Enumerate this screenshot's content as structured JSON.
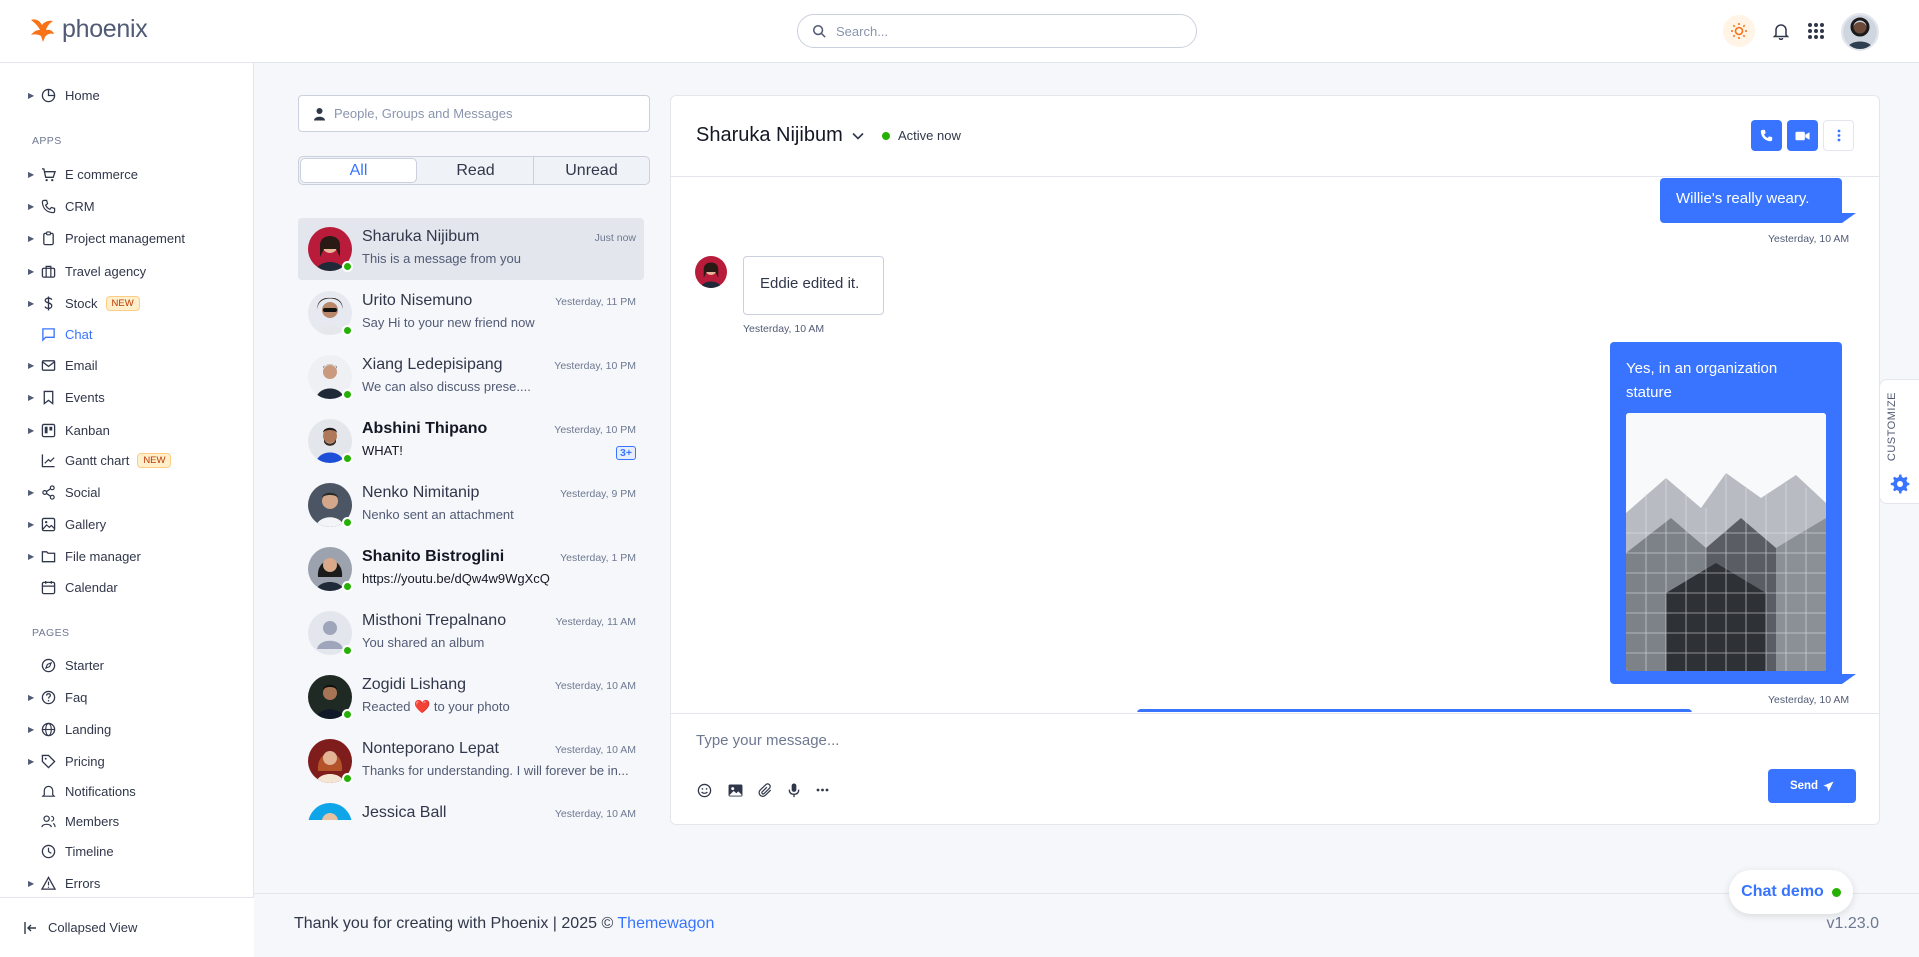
{
  "brand": {
    "name": "phoenix"
  },
  "topbar": {
    "search_placeholder": "Search..."
  },
  "sidebar": {
    "home": "Home",
    "apps_heading": "APPS",
    "apps": [
      {
        "label": "E commerce",
        "icon": "cart-icon"
      },
      {
        "label": "CRM",
        "icon": "phone-icon"
      },
      {
        "label": "Project management",
        "icon": "clipboard-icon"
      },
      {
        "label": "Travel agency",
        "icon": "briefcase-icon"
      },
      {
        "label": "Stock",
        "icon": "dollar-icon",
        "badge": "NEW"
      },
      {
        "label": "Chat",
        "icon": "message-square-icon",
        "active": true
      },
      {
        "label": "Email",
        "icon": "mail-icon"
      },
      {
        "label": "Events",
        "icon": "bookmark-icon"
      },
      {
        "label": "Kanban",
        "icon": "trello-icon"
      },
      {
        "label": "Gantt chart",
        "icon": "bar-chart-icon",
        "badge": "NEW"
      },
      {
        "label": "Social",
        "icon": "share-icon"
      },
      {
        "label": "Gallery",
        "icon": "image-icon"
      },
      {
        "label": "File manager",
        "icon": "folder-icon"
      },
      {
        "label": "Calendar",
        "icon": "calendar-icon"
      }
    ],
    "pages_heading": "PAGES",
    "pages": [
      {
        "label": "Starter",
        "icon": "compass-icon"
      },
      {
        "label": "Faq",
        "icon": "help-circle-icon"
      },
      {
        "label": "Landing",
        "icon": "globe-icon"
      },
      {
        "label": "Pricing",
        "icon": "tag-icon"
      },
      {
        "label": "Notifications",
        "icon": "bell-icon"
      },
      {
        "label": "Members",
        "icon": "users-icon"
      },
      {
        "label": "Timeline",
        "icon": "clock-icon"
      },
      {
        "label": "Errors",
        "icon": "alert-triangle-icon"
      }
    ],
    "collapse_label": "Collapsed View"
  },
  "conversations": {
    "search_placeholder": "People, Groups and Messages",
    "tabs": [
      "All",
      "Read",
      "Unread"
    ],
    "items": [
      {
        "name": "Sharuka Nijibum",
        "message": "This is a message from you",
        "time": "Just now",
        "bold": false,
        "active": true,
        "badge": ""
      },
      {
        "name": "Urito Nisemuno",
        "message": "Say Hi to your new friend now",
        "time": "Yesterday, 11 PM",
        "bold": false,
        "badge": ""
      },
      {
        "name": "Xiang Ledepisipang",
        "message": "We can also discuss prese....",
        "time": "Yesterday, 10 PM",
        "bold": false,
        "badge": ""
      },
      {
        "name": "Abshini Thipano",
        "message": "WHAT!",
        "time": "Yesterday, 10 PM",
        "bold": true,
        "badge": "3+"
      },
      {
        "name": "Nenko Nimitanip",
        "message": "Nenko sent an attachment",
        "time": "Yesterday, 9 PM",
        "bold": false,
        "badge": ""
      },
      {
        "name": "Shanito Bistroglini",
        "message": "https://youtu.be/dQw4w9WgXcQ",
        "time": "Yesterday, 1 PM",
        "bold": true,
        "badge": ""
      },
      {
        "name": "Misthoni Trepalnano",
        "message": "You shared an album",
        "time": "Yesterday, 11 AM",
        "bold": false,
        "badge": ""
      },
      {
        "name": "Zogidi Lishang",
        "message": "Reacted ❤️ to your photo",
        "time": "Yesterday, 10 AM",
        "bold": false,
        "badge": ""
      },
      {
        "name": "Nonteporano Lepat",
        "message": "Thanks for understanding. I will forever be in...",
        "time": "Yesterday, 10 AM",
        "bold": false,
        "badge": ""
      },
      {
        "name": "Jessica Ball",
        "message": "",
        "time": "Yesterday, 10 AM",
        "bold": false,
        "badge": ""
      }
    ]
  },
  "chat": {
    "contact_name": "Sharuka Nijibum",
    "status": "Active now",
    "messages": {
      "m1": {
        "text": "Willie's really weary.",
        "time": "Yesterday, 10 AM"
      },
      "m2": {
        "text": "Eddie edited it.",
        "time": "Yesterday, 10 AM"
      },
      "m3": {
        "text": "Yes, in an organization stature",
        "time": "Yesterday, 10 AM"
      }
    },
    "composer_placeholder": "Type your message...",
    "send_label": "Send"
  },
  "customize_label": "CUSTOMIZE",
  "footer": {
    "text": "Thank you for creating with Phoenix | 2025 © ",
    "link": "Themewagon",
    "version": "v1.23.0"
  },
  "chat_demo_label": "Chat demo",
  "colors": {
    "primary": "#3874ff",
    "online": "#25b003",
    "badge_bg": "#ffefca"
  }
}
